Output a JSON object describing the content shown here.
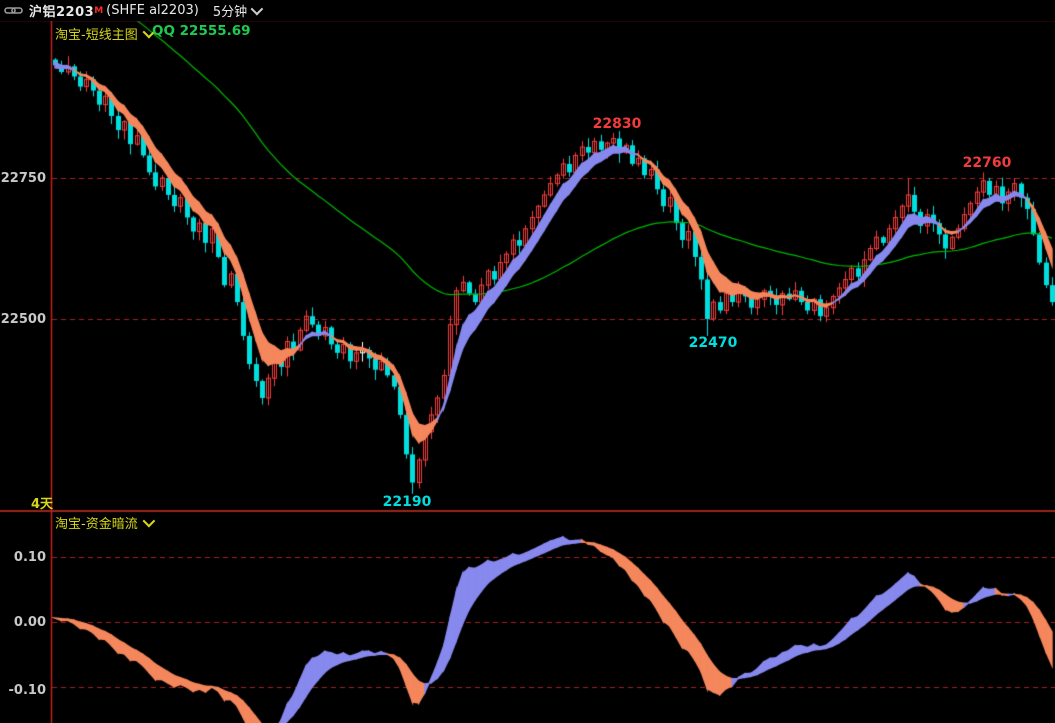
{
  "title_bar": {
    "link_icon": "chain-link-icon",
    "symbol": "沪铝2203",
    "symbol_flag": "M",
    "exchange": "(SHFE al2203)",
    "period": "5分钟"
  },
  "colors": {
    "background": "#000000",
    "axis_line": "#c42020",
    "grid_dash": "#a82020",
    "panel_divider": "#d03020",
    "topbar_divider": "#5f1010",
    "tick_text": "#c8c8c8",
    "header_text": "#d6d61a",
    "qq_text": "#1ecb4f",
    "candle_up": "#f23c3c",
    "candle_down": "#00dede",
    "candle_doji": "#ffffff",
    "ribbon_up": "#8789ee",
    "ribbon_down": "#f5875c",
    "ma_green": "#00b800"
  },
  "chart_data": [
    {
      "type": "candlestick",
      "title": "淘宝-短线主图",
      "readout": "QQ 22555.69",
      "range_label": "4天",
      "symbol": "沪铝2203 (SHFE al2203)",
      "period": "5分钟",
      "ylim": [
        22160,
        23023
      ],
      "y_gridlines": [
        22750,
        22500
      ],
      "grid": "dashed-red",
      "open_first": 22960,
      "closes": [
        22950,
        22938,
        22948,
        22930,
        22912,
        22925,
        22905,
        22880,
        22895,
        22860,
        22835,
        22850,
        22810,
        22825,
        22790,
        22760,
        22735,
        22750,
        22720,
        22700,
        22715,
        22680,
        22655,
        22670,
        22635,
        22660,
        22610,
        22560,
        22580,
        22530,
        22470,
        22420,
        22390,
        22360,
        22395,
        22430,
        22415,
        22460,
        22445,
        22480,
        22505,
        22490,
        22470,
        22485,
        22455,
        22440,
        22455,
        22425,
        22440,
        22445,
        22430,
        22410,
        22425,
        22400,
        22380,
        22330,
        22260,
        22210,
        22250,
        22300,
        22330,
        22360,
        22400,
        22490,
        22550,
        22565,
        22545,
        22530,
        22560,
        22585,
        22570,
        22600,
        22615,
        22640,
        22630,
        22660,
        22680,
        22700,
        22720,
        22740,
        22755,
        22775,
        22760,
        22790,
        22805,
        22795,
        22815,
        22800,
        22812,
        22820,
        22795,
        22808,
        22775,
        22785,
        22755,
        22765,
        22730,
        22700,
        22715,
        22670,
        22640,
        22655,
        22610,
        22570,
        22500,
        22530,
        22515,
        22545,
        22530,
        22555,
        22540,
        22520,
        22535,
        22550,
        22540,
        22525,
        22545,
        22535,
        22550,
        22530,
        22515,
        22535,
        22505,
        22520,
        22540,
        22555,
        22570,
        22590,
        22575,
        22605,
        22625,
        22645,
        22635,
        22660,
        22680,
        22700,
        22720,
        22690,
        22665,
        22685,
        22670,
        22650,
        22625,
        22645,
        22660,
        22685,
        22705,
        22725,
        22745,
        22720,
        22735,
        22705,
        22725,
        22740,
        22715,
        22695,
        22650,
        22600,
        22560,
        22530
      ],
      "extreme_overrides": {
        "2": {
          "high": 22966
        },
        "57": {
          "low": 22190
        },
        "89": {
          "high": 22830
        },
        "104": {
          "low": 22470
        },
        "136": {
          "high": 22750
        },
        "148": {
          "high": 22760
        },
        "153": {
          "high": 22750
        }
      },
      "annotations": [
        {
          "text": "22830",
          "kind": "swing-high",
          "color": "#f23c3c"
        },
        {
          "text": "22760",
          "kind": "swing-high",
          "color": "#f23c3c"
        },
        {
          "text": "22470",
          "kind": "swing-low",
          "color": "#00dede"
        },
        {
          "text": "22190",
          "kind": "swing-low",
          "color": "#00dede"
        }
      ],
      "series": [
        {
          "name": "trend-ribbon",
          "kind": "ema-band",
          "fast_period": 5,
          "slow_period": 8,
          "fast_seed": 22958,
          "slow_seed": 22944,
          "up_color": "#8789ee",
          "down_color": "#f5875c"
        },
        {
          "name": "slow-ma",
          "kind": "ema",
          "period": 58,
          "seed": 23120,
          "color": "#00b800"
        }
      ]
    },
    {
      "type": "area",
      "title": "淘宝-资金暗流",
      "ylim": [
        -0.155,
        0.145
      ],
      "y_gridlines": [
        "0.10",
        "0.00",
        "-0.10"
      ],
      "grid": "dashed-red",
      "oscillator": {
        "kind": "ema-spread-band",
        "base_fast_period": 5,
        "base_slow_period": 21,
        "base_slow_seed_offset": -6,
        "scale_divisor": 900,
        "signal_period": 7,
        "up_color": "#8789ee",
        "down_color": "#f5875c"
      }
    }
  ]
}
